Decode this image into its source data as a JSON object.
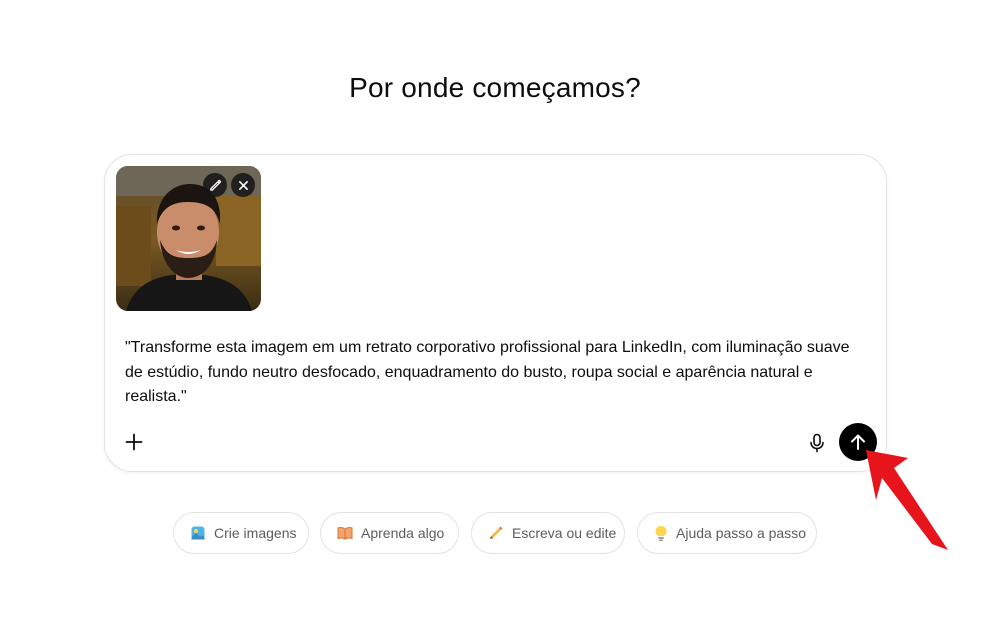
{
  "heading": "Por onde começamos?",
  "composer": {
    "attachment_alt": "uploaded photo",
    "prompt": "\"Transforme esta imagem em um retrato corporativo profissional para LinkedIn, com iluminação suave de estúdio, fundo neutro desfocado, enquadramento do busto, roupa social e aparência natural e realista.\"",
    "icons": {
      "edit": "pencil-icon",
      "remove": "close-icon",
      "add": "plus-icon",
      "voice": "microphone-icon",
      "send": "arrow-up-icon"
    }
  },
  "suggestions": [
    {
      "label": "Crie imagens",
      "icon": "image-icon"
    },
    {
      "label": "Aprenda algo",
      "icon": "book-icon"
    },
    {
      "label": "Escreva ou edite",
      "icon": "pencil-icon"
    },
    {
      "label": "Ajuda passo a passo",
      "icon": "lightbulb-icon"
    }
  ],
  "annotation": {
    "color": "#e8141b",
    "icon": "red-arrow-icon"
  },
  "colors": {
    "send_button": "#000000",
    "chip_text": "#5d5d5d",
    "border": "#e3e3e3"
  }
}
